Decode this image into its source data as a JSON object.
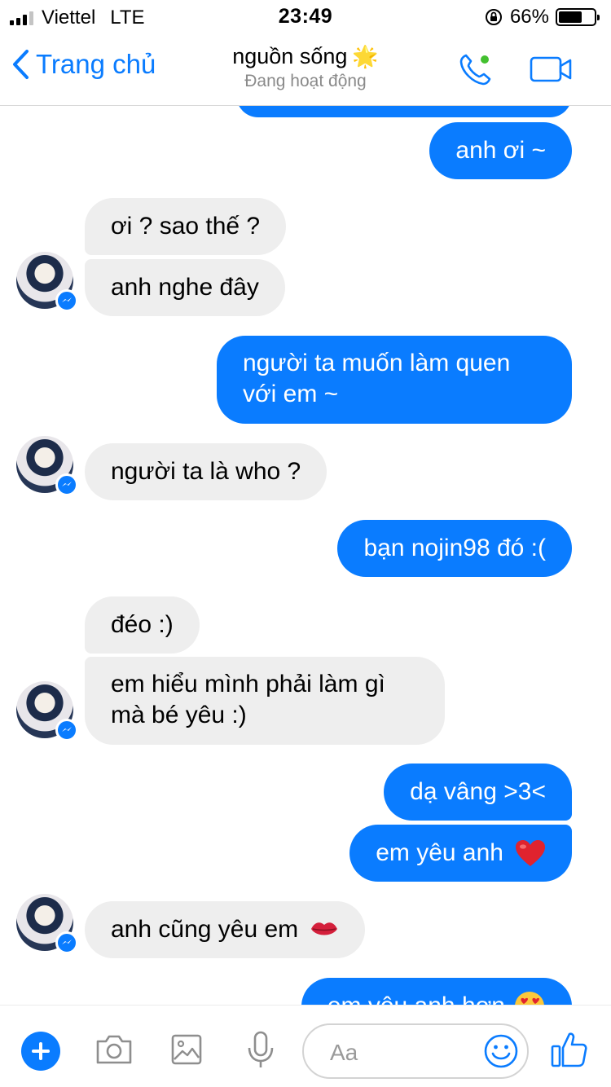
{
  "status_bar": {
    "carrier": "Viettel",
    "network": "LTE",
    "time": "23:49",
    "battery_percent": "66%",
    "battery_level": 0.66,
    "icons": [
      "signal-bars-icon",
      "orientation-lock-icon",
      "battery-icon"
    ]
  },
  "header": {
    "back_label": "Trang chủ",
    "contact_name": "nguồn sống",
    "contact_emoji": "🌟",
    "presence": "Đang hoạt động",
    "icons": [
      "chevron-left-icon",
      "phone-icon",
      "video-call-icon"
    ],
    "online_color": "#43c02f"
  },
  "colors": {
    "accent": "#0a7cff",
    "incoming_bubble": "#eeeeee",
    "outgoing_text": "#ffffff"
  },
  "messages": [
    {
      "direction": "out",
      "text": "anh ơi ~"
    },
    {
      "direction": "in",
      "text": "ơi ? sao thế ?"
    },
    {
      "direction": "in",
      "text": "anh nghe đây"
    },
    {
      "direction": "out",
      "text": "người ta muốn làm quen với em ~"
    },
    {
      "direction": "in",
      "text": "người ta là who ?"
    },
    {
      "direction": "out",
      "text": "bạn nojin98 đó :("
    },
    {
      "direction": "in",
      "text": "đéo :)"
    },
    {
      "direction": "in",
      "text": "em hiểu mình phải làm gì mà bé yêu :)"
    },
    {
      "direction": "out",
      "text": "dạ vâng >3<"
    },
    {
      "direction": "out",
      "text": "em yêu anh",
      "emoji": "red-heart"
    },
    {
      "direction": "in",
      "text": "anh cũng yêu em",
      "emoji": "kiss-mark"
    },
    {
      "direction": "out",
      "text": "em yêu anh hơn",
      "emoji": "heart-eyes"
    }
  ],
  "composer": {
    "placeholder": "Aa",
    "icons": [
      "plus-icon",
      "camera-icon",
      "photo-icon",
      "microphone-icon",
      "emoji-icon",
      "thumbs-up-icon"
    ]
  }
}
